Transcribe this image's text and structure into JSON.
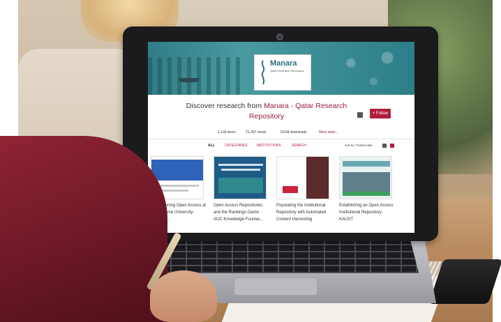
{
  "repository": {
    "logo_name": "Manara",
    "logo_sub": "Qatar Research Repository",
    "discover_prefix": "Discover research from ",
    "discover_accent": "Manara - Qatar Research Repository",
    "follow_label": "+ Follow",
    "accent_color": "#b01e3c",
    "banner_color": "#3e8f97"
  },
  "stats": {
    "items": "1,130 items",
    "views": "21,397 views",
    "downloads": "9,634 downloads",
    "more": "More stats..."
  },
  "tabs": {
    "all": "ALL",
    "categories": "CATEGORIES",
    "institutions": "INSTITUTIONS",
    "search": "SEARCH",
    "sort_label": "sort by: Posted date"
  },
  "cards": [
    {
      "title": "Championing Open Access at Notre Dame University-Louaize ..."
    },
    {
      "title": "Open Access Repositories and the Rankings Game: AUC Knowledge Fountai..."
    },
    {
      "title": "Populating the Institutional Repository with Automated Content Harvesting"
    },
    {
      "title": "Establishing an Open Access Institutional Repository: KAUST"
    }
  ]
}
